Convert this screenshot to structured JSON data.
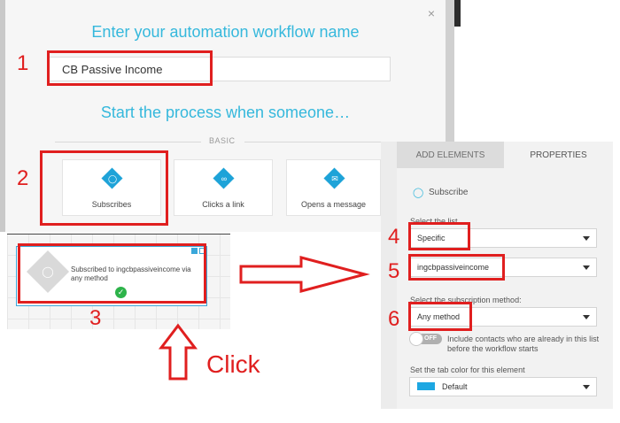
{
  "dialog": {
    "title": "Enter your automation workflow name",
    "workflow_name_value": "CB Passive Income",
    "start_heading": "Start the process when someone…",
    "section_label": "BASIC",
    "triggers": [
      {
        "label": "Subscribes",
        "icon": "user-icon"
      },
      {
        "label": "Clicks a link",
        "icon": "link-icon"
      },
      {
        "label": "Opens a message",
        "icon": "envelope-icon"
      }
    ]
  },
  "canvas": {
    "node_text": "Subscribed to ingcbpassiveincome via any method",
    "node_status_icon": "check-icon"
  },
  "properties": {
    "tabs": [
      "ADD ELEMENTS",
      "PROPERTIES"
    ],
    "element_title": "Subscribe",
    "select_list_label": "Select the list",
    "list_type_value": "Specific",
    "list_name_value": "ingcbpassiveincome",
    "subscription_method_label": "Select the subscription method:",
    "subscription_method_value": "Any method",
    "toggle_state": "OFF",
    "include_contacts_text": "Include contacts who are already in this list before the workflow starts",
    "tab_color_label": "Set the tab color for this element",
    "tab_color_value": "Default",
    "tab_color_swatch": "#1da7e2"
  },
  "annotations": {
    "numbers": [
      "1",
      "2",
      "3",
      "4",
      "5",
      "6"
    ],
    "click_label": "Click",
    "color": "#e01f1f"
  }
}
